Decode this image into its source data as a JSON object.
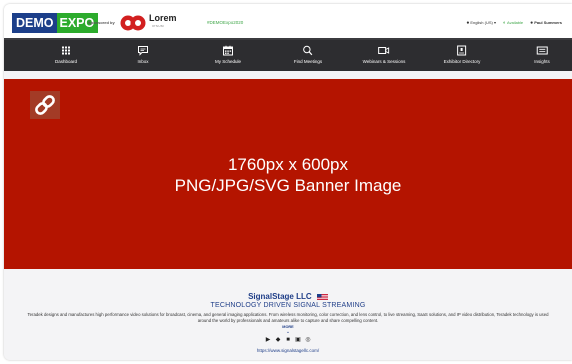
{
  "header": {
    "logo_word1": "DEMO",
    "logo_word2": "EXPO",
    "sponsored_by": "Sponsored by",
    "sponsor_name": "Lorem",
    "sponsor_sub": "IPSUM",
    "hashtag": "#DEMOExpo2020",
    "language": "English (US) ▾",
    "status": "Available",
    "user": "Paul Summers",
    "language_icon": "globe-icon",
    "status_icon": "toggle-icon",
    "user_icon": "user-icon"
  },
  "nav": {
    "items": [
      {
        "label": "Dashboard",
        "icon": "grid-icon"
      },
      {
        "label": "Inbox",
        "icon": "chat-icon"
      },
      {
        "label": "My Schedule",
        "icon": "calendar-icon"
      },
      {
        "label": "Find Meetings",
        "icon": "search-icon"
      },
      {
        "label": "Webinars & Sessions",
        "icon": "video-icon"
      },
      {
        "label": "Exhibitor Directory",
        "icon": "badge-icon"
      },
      {
        "label": "Insights",
        "icon": "insights-icon"
      }
    ]
  },
  "banner": {
    "line1": "1760px x 600px",
    "line2": "PNG/JPG/SVG Banner Image",
    "link_icon": "link-icon"
  },
  "company": {
    "name": "SignalStage LLC",
    "tagline": "TECHNOLOGY DRIVEN SIGNAL STREAMING",
    "description": "Teradek designs and manufactures high performance video solutions for broadcast, cinema, and general imaging applications. From wireless monitoring, color correction, and lens control, to live streaming, SaaS solutions, and IP video distribution, Teradek technology is used around the world by professionals and amateurs alike to capture and share compelling content.",
    "more": "MORE",
    "website": "https://www.signalstagellc.com/",
    "social_icons": [
      "youtube-icon",
      "twitter-icon",
      "facebook-icon",
      "linkedin-icon",
      "instagram-icon"
    ]
  },
  "colors": {
    "banner_bg": "#b41400",
    "nav_bg": "#2d2d30",
    "logo_blue": "#1c3f8a",
    "logo_green": "#2cab2c",
    "accent_green": "#3fa648",
    "brand_navy": "#1f3e88"
  }
}
